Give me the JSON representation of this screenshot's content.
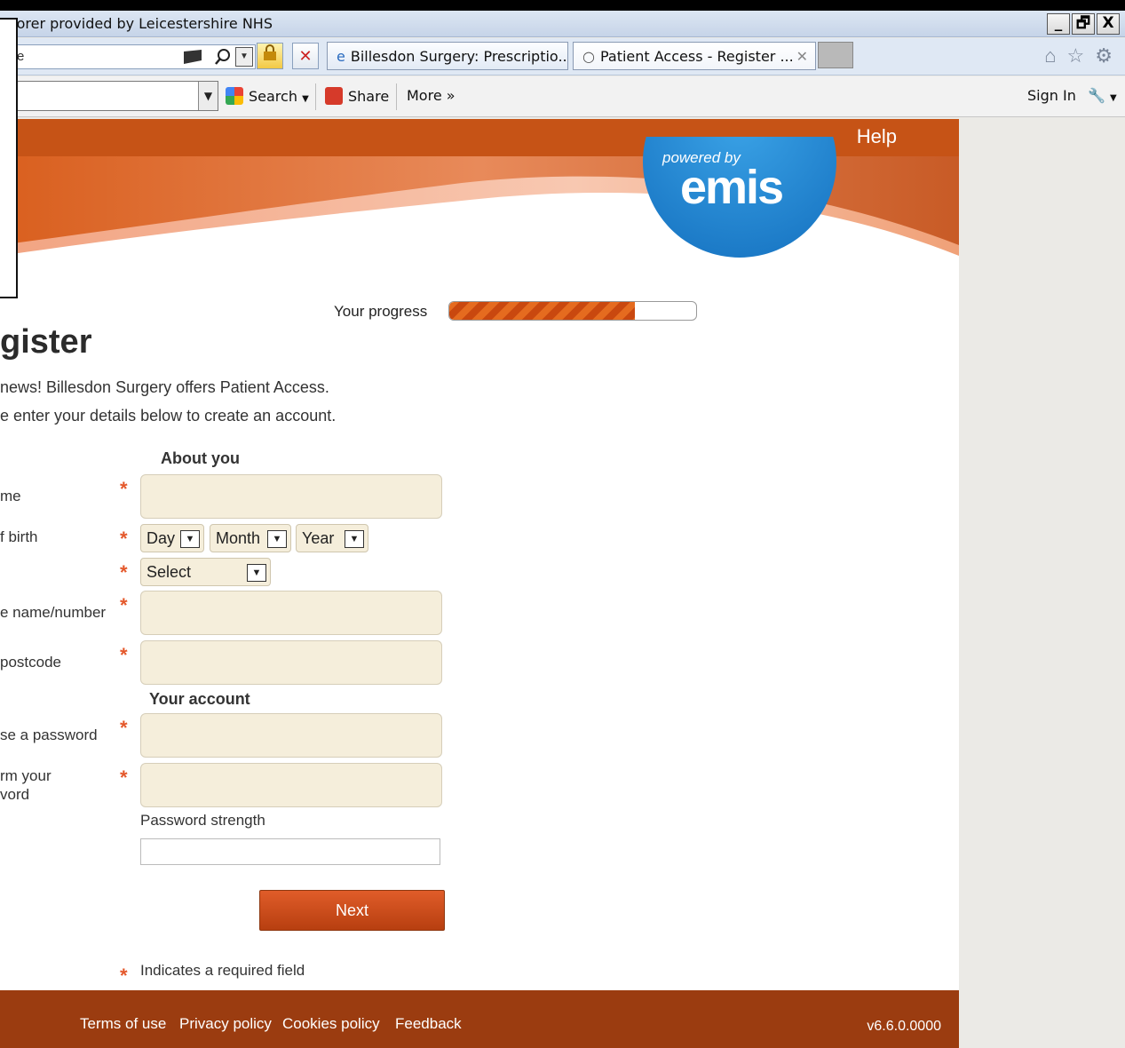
{
  "browser": {
    "window_title": "plorer provided by Leicestershire NHS",
    "address_text": "e",
    "tabs": [
      {
        "label": "Billesdon Surgery: Prescriptio..."
      },
      {
        "label": "Patient Access   - Register ..."
      }
    ],
    "window_buttons": {
      "minimize": "_",
      "restore": "🗗",
      "close": "X"
    },
    "toolbar": {
      "search_label": "Search",
      "share_label": "Share",
      "more_label": "More »",
      "signin_label": "Sign In"
    }
  },
  "header": {
    "help_label": "Help",
    "logo_tagline": "powered by",
    "logo_name": "emis"
  },
  "progress": {
    "label": "Your progress",
    "percent": 75
  },
  "form": {
    "title": "gister",
    "intro_line1": "news! Billesdon Surgery offers Patient Access.",
    "intro_line2": "e enter your details below to create an account.",
    "section_about": "About you",
    "section_account": "Your account",
    "labels": {
      "name": "me",
      "dob": "f birth",
      "gender": "",
      "house": "e name/number",
      "postcode": "postcode",
      "password": "se a password",
      "confirm_line1": "rm your",
      "confirm_line2": "vord"
    },
    "dob_day": "Day",
    "dob_month": "Month",
    "dob_year": "Year",
    "gender_select": "Select",
    "password_strength_label": "Password strength",
    "next_label": "Next",
    "required_note": "Indicates a required field",
    "star": "*"
  },
  "footer": {
    "links": [
      "Terms of use",
      "Privacy policy",
      "Cookies policy",
      "Feedback"
    ],
    "version": "v6.6.0.0000"
  },
  "colors": {
    "brand_orange": "#c65316",
    "footer_brown": "#9b3c10",
    "field_bg": "#f5eedb",
    "emis_blue": "#1f8ad6"
  }
}
